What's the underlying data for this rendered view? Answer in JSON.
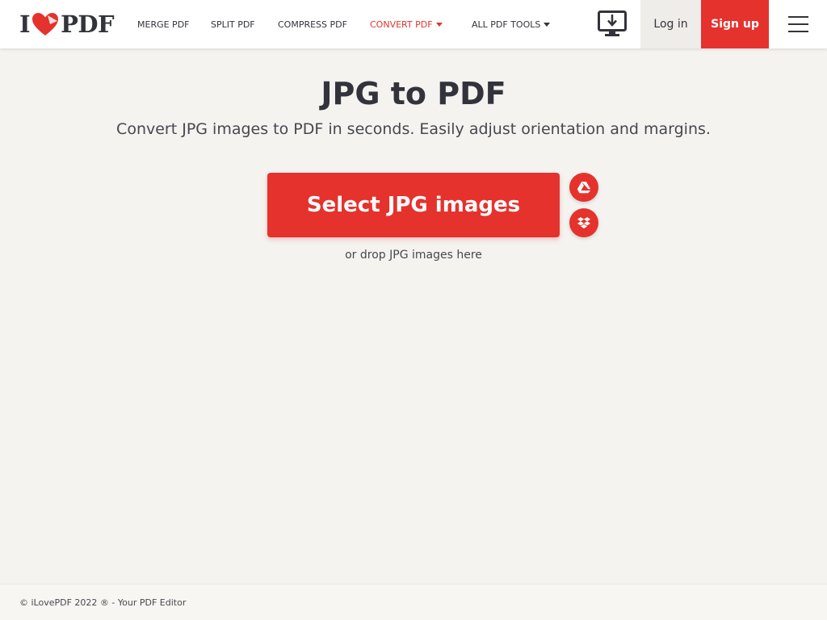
{
  "header": {
    "logo": {
      "left": "I",
      "right": "PDF"
    },
    "nav": [
      {
        "label": "MERGE PDF"
      },
      {
        "label": "SPLIT PDF"
      },
      {
        "label": "COMPRESS PDF"
      },
      {
        "label": "CONVERT PDF",
        "active": true,
        "has_dropdown": true
      },
      {
        "label": "ALL PDF TOOLS",
        "has_dropdown": true
      }
    ],
    "desktop_icon": "desktop-download-icon",
    "login_label": "Log in",
    "signup_label": "Sign up",
    "menu_icon": "hamburger-menu-icon"
  },
  "main": {
    "title": "JPG to PDF",
    "subtitle": "Convert JPG images to PDF in seconds. Easily adjust orientation and margins.",
    "select_button_label": "Select JPG images",
    "cloud_sources": [
      {
        "icon": "google-drive-icon"
      },
      {
        "icon": "dropbox-icon"
      }
    ],
    "drop_hint": "or drop JPG images here"
  },
  "footer": {
    "copyright": "© iLovePDF 2022 ® - Your PDF Editor"
  },
  "colors": {
    "brand_red": "#e5322d",
    "text_dark": "#33333b",
    "background": "#f4f3f0"
  }
}
